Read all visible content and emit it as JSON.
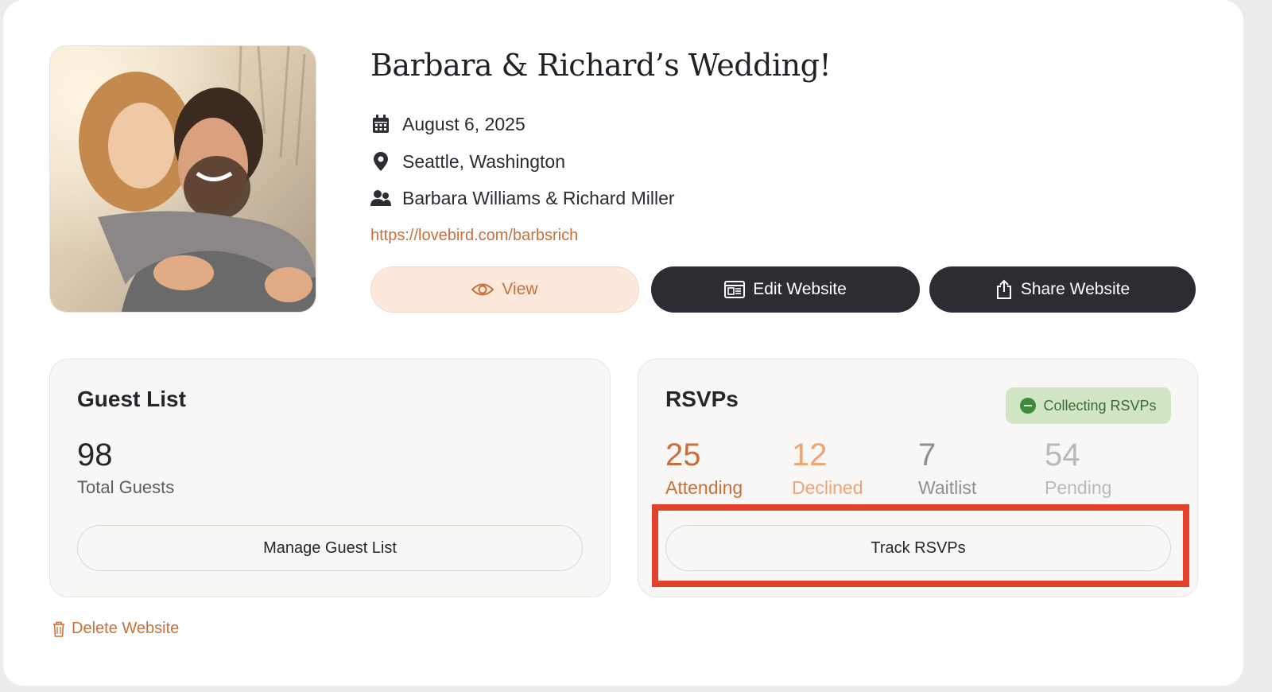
{
  "event": {
    "title": "Barbara & Richard’s Wedding!",
    "date": "August 6, 2025",
    "location": "Seattle, Washington",
    "couple": "Barbara Williams & Richard Miller",
    "url": "https://lovebird.com/barbsrich"
  },
  "actions": {
    "view_label": "View",
    "edit_label": "Edit Website",
    "share_label": "Share Website"
  },
  "guest_list": {
    "title": "Guest List",
    "total": "98",
    "total_label": "Total Guests",
    "manage_label": "Manage Guest List"
  },
  "rsvps": {
    "title": "RSVPs",
    "status_badge": "Collecting RSVPs",
    "stats": [
      {
        "value": "25",
        "label": "Attending"
      },
      {
        "value": "12",
        "label": "Declined"
      },
      {
        "value": "7",
        "label": "Waitlist"
      },
      {
        "value": "54",
        "label": "Pending"
      }
    ],
    "track_label": "Track RSVPs"
  },
  "delete_label": "Delete Website",
  "colors": {
    "accent": "#c9703a",
    "dark_button": "#2b2d33",
    "view_button_bg": "#fce9dc",
    "badge_bg": "#d2e6c6",
    "badge_text": "#3d6b34",
    "highlight": "#e2402a"
  },
  "icons": [
    "calendar-icon",
    "location-pin-icon",
    "users-icon",
    "eye-icon",
    "website-edit-icon",
    "share-icon",
    "minus-circle-icon",
    "trash-icon"
  ]
}
